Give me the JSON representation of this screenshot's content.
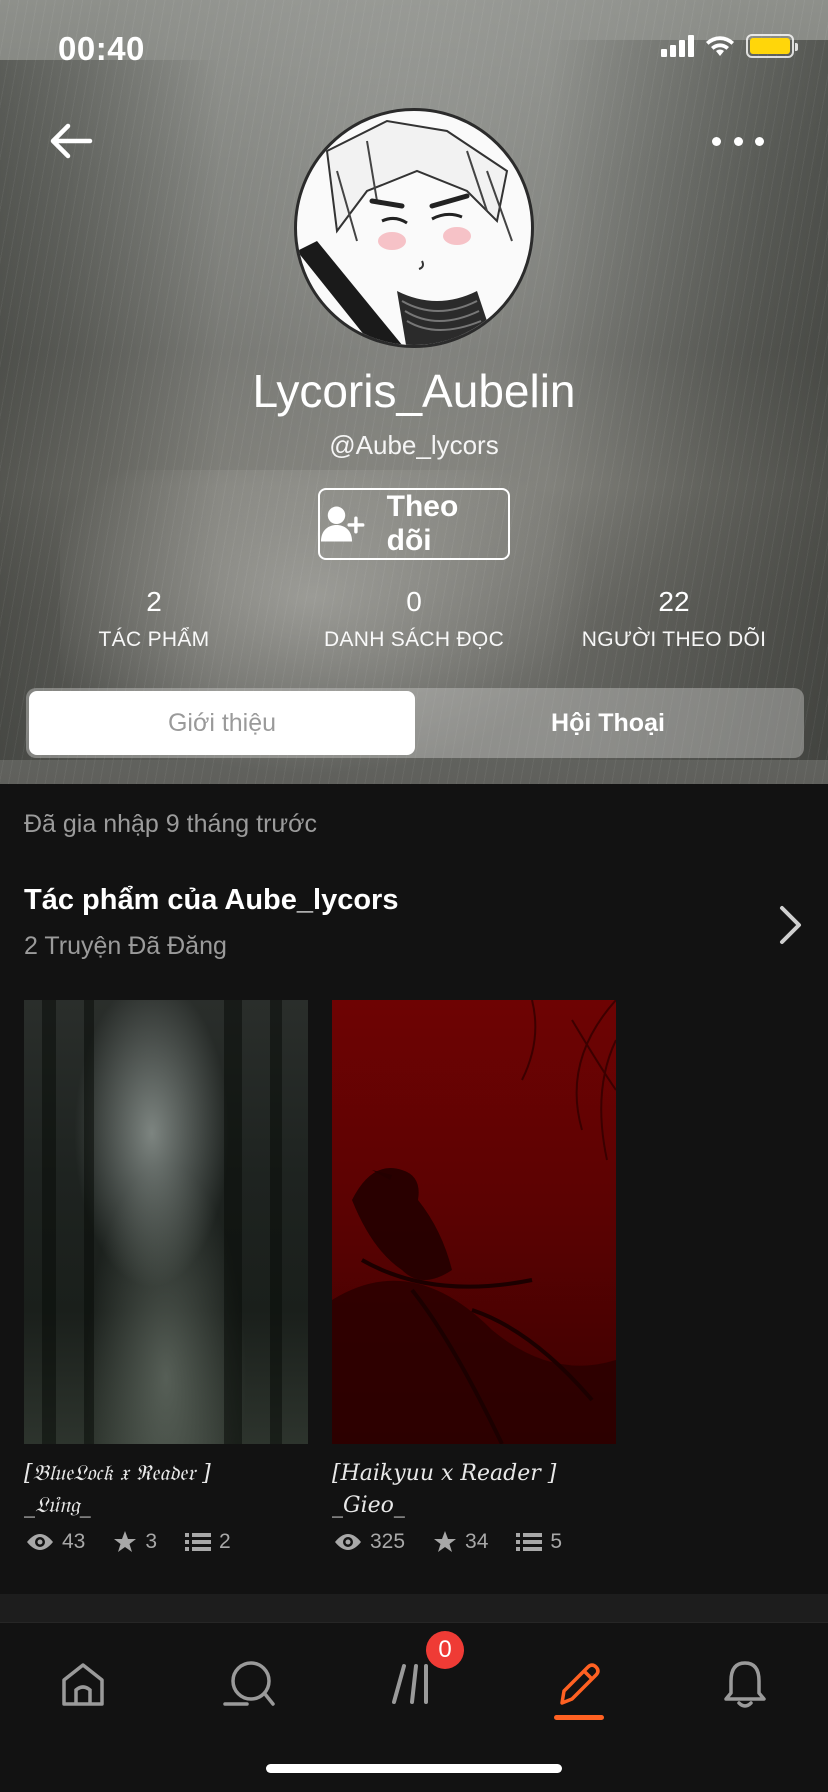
{
  "status_bar": {
    "time": "00:40",
    "battery_color": "#ffd60a"
  },
  "header": {
    "back_icon": "arrow-left-icon",
    "more_icon": "more-horizontal-icon"
  },
  "profile": {
    "display_name": "Lycoris_Aubelin",
    "handle": "@Aube_lycors",
    "follow_label": "Theo dõi",
    "follow_icon": "add-user-icon"
  },
  "stats": [
    {
      "value": "2",
      "label": "TÁC PHẨM"
    },
    {
      "value": "0",
      "label": "DANH SÁCH ĐỌC"
    },
    {
      "value": "22",
      "label": "NGƯỜI THEO DÕI"
    }
  ],
  "tabs": [
    {
      "label": "Giới thiệu",
      "active": true
    },
    {
      "label": "Hội Thoại",
      "active": false
    }
  ],
  "about": {
    "joined": "Đã gia nhập 9 tháng trước"
  },
  "works": {
    "title": "Tác phẩm của Aube_lycors",
    "subtitle": "2 Truyện Đã Đăng",
    "stories": [
      {
        "title_line1": "[𝔅𝔩𝔲𝔢𝔏𝔬𝔠𝔨 𝔵 ℜ𝔢𝔞𝔡𝔢𝔯 ]",
        "title_line2": "_𝔏𝔲̉𝔫𝔤_",
        "reads": "43",
        "votes": "3",
        "parts": "2"
      },
      {
        "title_line1": "[Haikyuu x Reader ] _Gieo_",
        "title_line2": "",
        "reads": "325",
        "votes": "34",
        "parts": "5"
      }
    ]
  },
  "bottom_nav": {
    "items": [
      "home-icon",
      "search-icon",
      "library-icon",
      "write-icon",
      "notifications-icon"
    ],
    "library_badge": "0",
    "accent": "#ff6122"
  }
}
